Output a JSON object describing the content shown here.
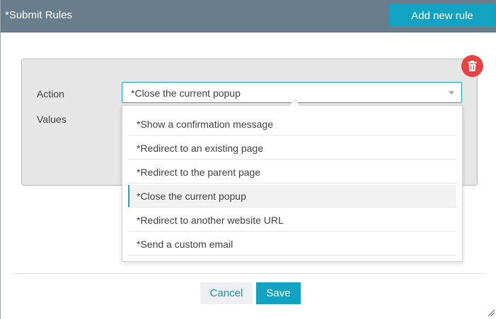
{
  "header": {
    "title": "*Submit Rules",
    "add_rule_label": "Add new rule"
  },
  "rule": {
    "action_label": "Action",
    "values_label": "Values",
    "action_selected": "*Close the current popup"
  },
  "dropdown": {
    "options": [
      "*Show a confirmation message",
      "*Redirect to an existing page",
      "*Redirect to the parent page",
      "*Close the current popup",
      "*Redirect to another website URL",
      "*Send a custom email"
    ],
    "selected_index": 3
  },
  "footer": {
    "cancel_label": "Cancel",
    "save_label": "Save"
  },
  "colors": {
    "header_bg": "#6a7d8c",
    "accent": "#13a3c2",
    "delete": "#e84343"
  },
  "icons": {
    "delete": "trash-icon",
    "select_arrow": "caret-down-icon",
    "resize": "resize-grip-icon"
  }
}
